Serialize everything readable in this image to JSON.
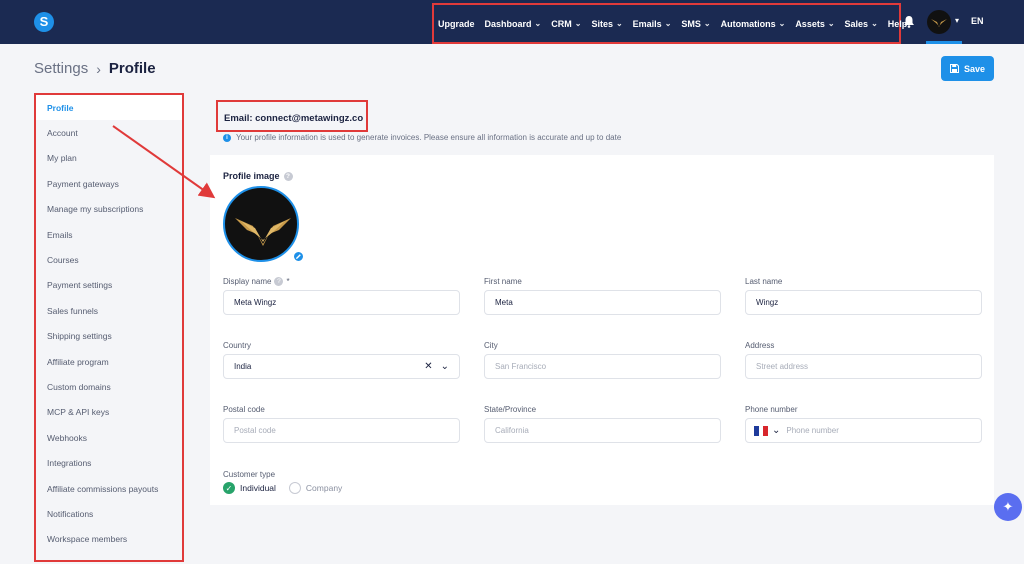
{
  "topbar": {
    "logo_letter": "S",
    "nav": [
      {
        "label": "Upgrade",
        "chevron": false
      },
      {
        "label": "Dashboard",
        "chevron": true
      },
      {
        "label": "CRM",
        "chevron": true
      },
      {
        "label": "Sites",
        "chevron": true
      },
      {
        "label": "Emails",
        "chevron": true
      },
      {
        "label": "SMS",
        "chevron": true
      },
      {
        "label": "Automations",
        "chevron": true
      },
      {
        "label": "Assets",
        "chevron": true
      },
      {
        "label": "Sales",
        "chevron": true
      },
      {
        "label": "Help",
        "chevron": false
      }
    ],
    "language": "EN",
    "icons": {
      "notifications": "bell-icon",
      "account": "avatar"
    }
  },
  "header": {
    "breadcrumb_parent": "Settings",
    "breadcrumb_current": "Profile",
    "save_label": "Save"
  },
  "sidebar": {
    "items": [
      {
        "label": "Profile",
        "active": true
      },
      {
        "label": "Account"
      },
      {
        "label": "My plan"
      },
      {
        "label": "Payment gateways"
      },
      {
        "label": "Manage my subscriptions"
      },
      {
        "label": "Emails"
      },
      {
        "label": "Courses"
      },
      {
        "label": "Payment settings"
      },
      {
        "label": "Sales funnels"
      },
      {
        "label": "Shipping settings"
      },
      {
        "label": "Affiliate program"
      },
      {
        "label": "Custom domains"
      },
      {
        "label": "MCP & API keys"
      },
      {
        "label": "Webhooks"
      },
      {
        "label": "Integrations"
      },
      {
        "label": "Affiliate commissions payouts"
      },
      {
        "label": "Notifications"
      },
      {
        "label": "Workspace members"
      }
    ]
  },
  "profile": {
    "email_line": "Email: connect@metawingz.co",
    "info_text": "Your profile information is used to generate invoices. Please ensure all information is accurate and up to date",
    "image_label": "Profile image",
    "fields": {
      "display_name": {
        "label": "Display name",
        "required_mark": "*",
        "value": "Meta Wingz"
      },
      "first_name": {
        "label": "First name",
        "value": "Meta"
      },
      "last_name": {
        "label": "Last name",
        "value": "Wingz"
      },
      "country": {
        "label": "Country",
        "value": "India"
      },
      "city": {
        "label": "City",
        "placeholder": "San Francisco"
      },
      "address": {
        "label": "Address",
        "placeholder": "Street address"
      },
      "postal_code": {
        "label": "Postal code",
        "placeholder": "Postal code"
      },
      "state": {
        "label": "State/Province",
        "placeholder": "California"
      },
      "phone": {
        "label": "Phone number",
        "placeholder": "Phone number"
      }
    },
    "customer_type": {
      "label": "Customer type",
      "options": [
        "Individual",
        "Company"
      ],
      "selected": "Individual"
    }
  },
  "colors": {
    "topbar": "#1b2a52",
    "accent": "#1e90e8",
    "annotation": "#e03a3a",
    "success": "#27a36a"
  }
}
